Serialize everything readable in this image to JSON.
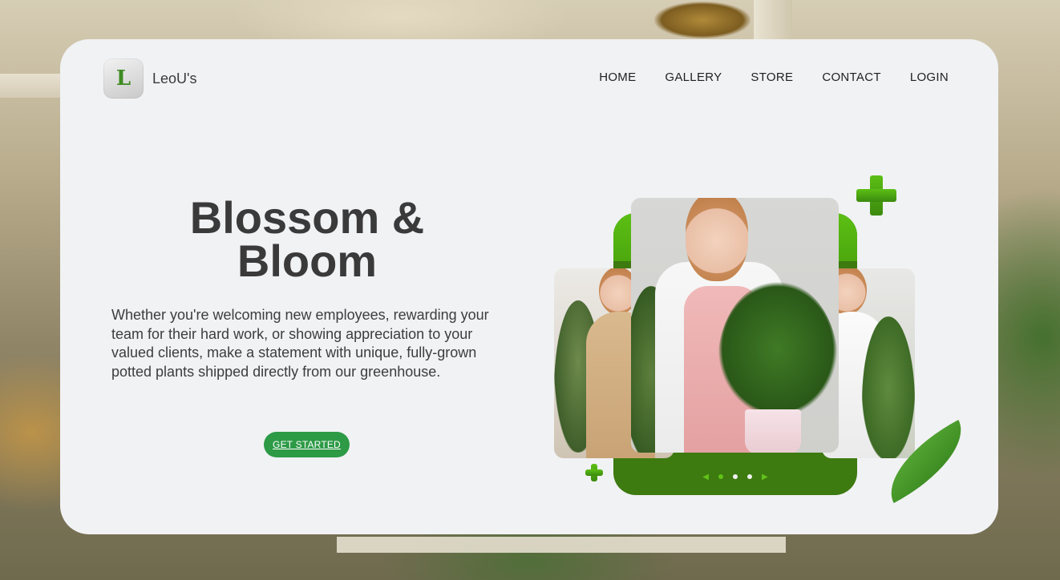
{
  "brand": {
    "name": "LeoU's",
    "logo_letter": "L"
  },
  "nav": {
    "items": [
      "HOME",
      "GALLERY",
      "STORE",
      "CONTACT",
      "LOGIN"
    ]
  },
  "hero": {
    "title_line1": "Blossom &",
    "title_line2": "Bloom",
    "copy": "Whether you're welcoming new employees, rewarding your team for their hard work, or showing appreciation to your valued clients, make a statement with unique, fully-grown potted plants shipped directly from our greenhouse.",
    "cta_label": "GET STARTED"
  },
  "carousel": {
    "prev_arrow": "◀",
    "next_arrow": "▶",
    "dots": 3,
    "active_dot": 0
  },
  "colors": {
    "accent_green": "#2d9a46",
    "frame_green": "#3d7a10",
    "bright_green": "#5cbf14",
    "card_bg": "#f1f2f4",
    "text_dark": "#3a3a3a"
  },
  "icons": {
    "logo": "plant-logo-icon",
    "decor_plus": "plus-icon",
    "decor_leaf": "leaf-icon"
  }
}
